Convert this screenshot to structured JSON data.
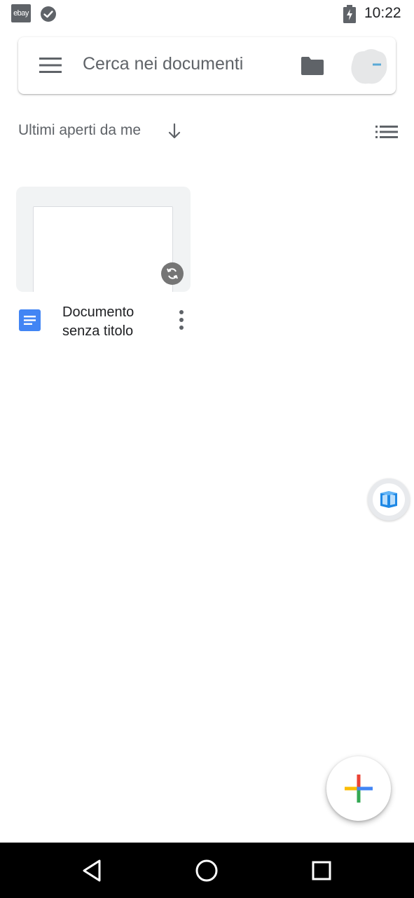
{
  "status_bar": {
    "time": "10:22",
    "ebay_label": "ebay",
    "icons": [
      "ebay-app-icon",
      "check-circle-icon",
      "battery-charging-icon"
    ]
  },
  "search": {
    "placeholder": "Cerca nei documenti",
    "icons": [
      "menu-icon",
      "folder-icon",
      "avatar"
    ]
  },
  "sort": {
    "label": "Ultimi aperti da me",
    "direction_icon": "arrow-down-icon",
    "view_icon": "list-view-icon"
  },
  "documents": [
    {
      "title_line1": "Documento",
      "title_line2": "senza titolo",
      "type_icon": "docs-icon",
      "status_icon": "sync-icon"
    }
  ],
  "fab": {
    "icon": "plus-icon"
  },
  "nav": {
    "icons": [
      "back-icon",
      "home-icon",
      "recents-icon"
    ]
  },
  "colors": {
    "google_blue": "#4285f4",
    "google_red": "#ea4335",
    "google_yellow": "#fbbc04",
    "google_green": "#34a853",
    "text_secondary": "#5f6368"
  }
}
